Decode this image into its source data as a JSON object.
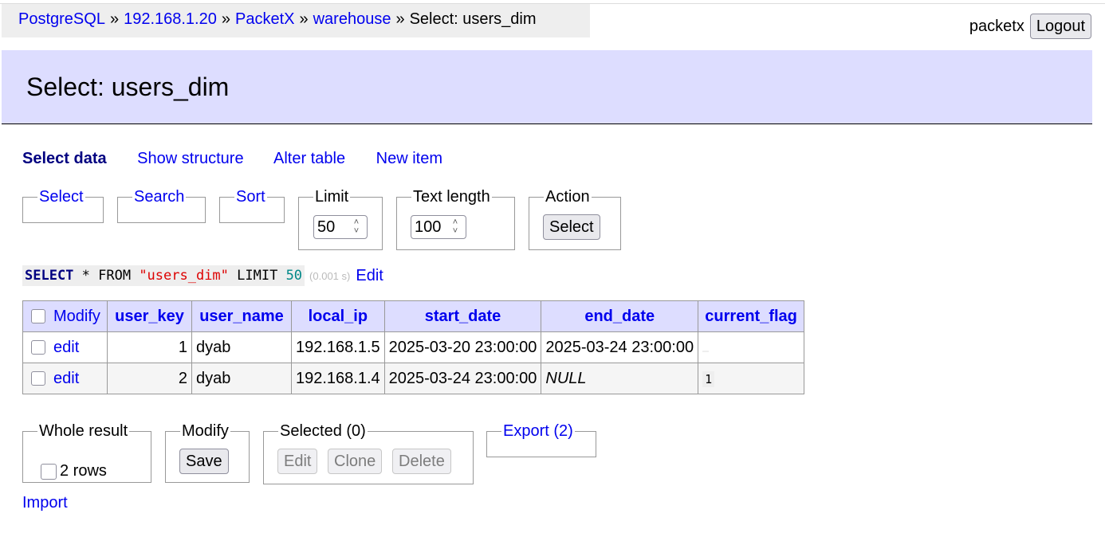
{
  "breadcrumb": {
    "items": [
      "PostgreSQL",
      "192.168.1.20",
      "PacketX",
      "warehouse"
    ],
    "current": "Select: users_dim",
    "separator": "»"
  },
  "user": {
    "name": "packetx",
    "logout_label": "Logout"
  },
  "header": {
    "title": "Select: users_dim"
  },
  "links": {
    "select_data": "Select data",
    "show_structure": "Show structure",
    "alter_table": "Alter table",
    "new_item": "New item"
  },
  "filters": {
    "select": "Select",
    "search": "Search",
    "sort": "Sort",
    "limit_legend": "Limit",
    "limit_value": "50",
    "text_length_legend": "Text length",
    "text_length_value": "100",
    "action_legend": "Action",
    "action_button": "Select"
  },
  "query": {
    "kw_select": "SELECT",
    "star_from": " * FROM ",
    "table": "\"users_dim\"",
    "kw_limit": " LIMIT ",
    "limit": "50",
    "time": "(0.001 s)",
    "edit_label": "Edit"
  },
  "table": {
    "modify_header": "Modify",
    "columns": [
      "user_key",
      "user_name",
      "local_ip",
      "start_date",
      "end_date",
      "current_flag"
    ],
    "edit_label": "edit",
    "rows": [
      {
        "user_key": "1",
        "user_name": "dyab",
        "local_ip": "192.168.1.5",
        "start_date": "2025-03-20 23:00:00",
        "end_date": "2025-03-24 23:00:00",
        "current_flag": ""
      },
      {
        "user_key": "2",
        "user_name": "dyab",
        "local_ip": "192.168.1.4",
        "start_date": "2025-03-24 23:00:00",
        "end_date": "NULL",
        "current_flag": "1"
      }
    ]
  },
  "bottom": {
    "whole_result_legend": "Whole result",
    "rows_label": "2 rows",
    "modify_legend": "Modify",
    "save_label": "Save",
    "selected_legend": "Selected (0)",
    "edit_label": "Edit",
    "clone_label": "Clone",
    "delete_label": "Delete",
    "export_label": "Export (2)",
    "import_label": "Import"
  }
}
